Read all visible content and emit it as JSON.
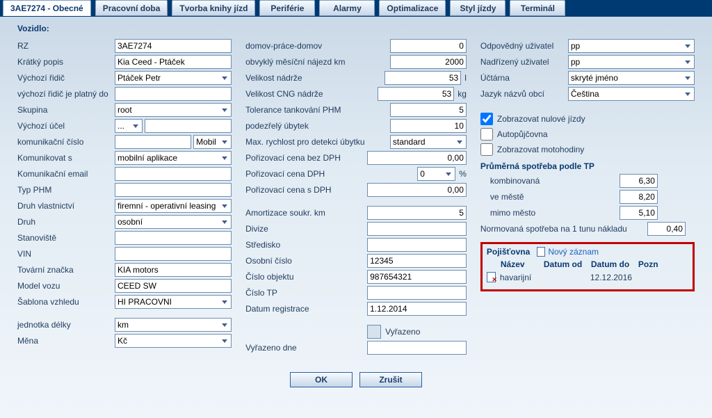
{
  "tabs": {
    "obecne": "3AE7274 - Obecné",
    "pracovni": "Pracovní doba",
    "tvorba": "Tvorba knihy jízd",
    "periferie": "Periférie",
    "alarmy": "Alarmy",
    "optimalizace": "Optimalizace",
    "styl": "Styl jízdy",
    "terminal": "Terminál"
  },
  "section": "Vozidlo:",
  "col1": {
    "rz": {
      "label": "RZ",
      "value": "3AE7274"
    },
    "kratky": {
      "label": "Krátký popis",
      "value": "Kia Ceed - Ptáček"
    },
    "ridic": {
      "label": "Výchozí řidič",
      "value": "Ptáček Petr"
    },
    "platny": {
      "label": "výchozí řidič je platný do",
      "value": ""
    },
    "skupina": {
      "label": "Skupina",
      "value": "root"
    },
    "ucel": {
      "label": "Výchozí účel",
      "value": "..."
    },
    "komcislo": {
      "label": "komunikační číslo",
      "value": "",
      "mode": "Mobil"
    },
    "komunikovat": {
      "label": "Komunikovat s",
      "value": "mobilní aplikace"
    },
    "email": {
      "label": "Komunikační email",
      "value": ""
    },
    "typphm": {
      "label": "Typ PHM",
      "value": ""
    },
    "vlastnictvi": {
      "label": "Druh vlastnictví",
      "value": "firemní - operativní leasing"
    },
    "druh": {
      "label": "Druh",
      "value": "osobní"
    },
    "stanoviste": {
      "label": "Stanoviště",
      "value": ""
    },
    "vin": {
      "label": "VIN",
      "value": ""
    },
    "znacka": {
      "label": "Tovární značka",
      "value": "KIA motors"
    },
    "model": {
      "label": "Model vozu",
      "value": "CEED SW"
    },
    "sablona": {
      "label": "Šablona vzhledu",
      "value": "HI PRACOVNI"
    },
    "delka": {
      "label": "jednotka délky",
      "value": "km"
    },
    "mena": {
      "label": "Měna",
      "value": "Kč"
    }
  },
  "col2": {
    "dpd": {
      "label": "domov-práce-domov",
      "value": "0"
    },
    "najezd": {
      "label": "obvyklý měsíční nájezd km",
      "value": "2000"
    },
    "nadrz": {
      "label": "Velikost nádrže",
      "value": "53",
      "unit": "l"
    },
    "cng": {
      "label": "Velikost CNG nádrže",
      "value": "53",
      "unit": "kg"
    },
    "tolerance": {
      "label": "Tolerance tankování PHM",
      "value": "5"
    },
    "ubytek": {
      "label": "podezřelý úbytek",
      "value": "10"
    },
    "maxrychl": {
      "label": "Max. rychlost pro detekci úbytku",
      "value": "standard"
    },
    "cenabez": {
      "label": "Pořizovací cena bez DPH",
      "value": "0,00"
    },
    "dph": {
      "label": "Pořizovací cena DPH",
      "sel": "0",
      "unit": "%"
    },
    "cenas": {
      "label": "Pořizovací cena s DPH",
      "value": "0,00"
    },
    "amort": {
      "label": "Amortizace soukr. km",
      "value": "5"
    },
    "divize": {
      "label": "Divize",
      "value": ""
    },
    "stredisko": {
      "label": "Středisko",
      "value": ""
    },
    "oscislo": {
      "label": "Osobní číslo",
      "value": "12345"
    },
    "objekt": {
      "label": "Číslo objektu",
      "value": "987654321"
    },
    "tp": {
      "label": "Číslo TP",
      "value": ""
    },
    "datumreg": {
      "label": "Datum registrace",
      "value": "1.12.2014"
    },
    "vyrazeno": {
      "label": "Vyřazeno"
    },
    "vyrazdne": {
      "label": "Vyřazeno dne",
      "value": ""
    }
  },
  "col3": {
    "odpovedny": {
      "label": "Odpovědný uživatel",
      "value": "pp"
    },
    "nadrizeny": {
      "label": "Nadřízený uživatel",
      "value": "pp"
    },
    "uctarna": {
      "label": "Účtárna",
      "value": "skryté jméno"
    },
    "jazyk": {
      "label": "Jazyk názvů obcí",
      "value": "Čeština"
    },
    "chk_nulove": "Zobrazovat nulové jízdy",
    "chk_autop": "Autopůjčovna",
    "chk_moto": "Zobrazovat motohodiny",
    "spotreba_title": "Průměrná spotřeba podle TP",
    "kombi": {
      "label": "kombinovaná",
      "value": "6,30"
    },
    "mesto": {
      "label": "ve městě",
      "value": "8,20"
    },
    "mimo": {
      "label": "mimo město",
      "value": "5,10"
    },
    "norm": {
      "label": "Normovaná spotřeba na 1 tunu nákladu",
      "value": "0,40"
    },
    "ins_title": "Pojišťovna",
    "ins_new": "Nový záznam",
    "ins_hd": {
      "nazev": "Název",
      "od": "Datum od",
      "do": "Datum do",
      "pozn": "Pozn"
    },
    "ins_row": {
      "nazev": "havarijní",
      "od": "",
      "do": "12.12.2016",
      "pozn": ""
    }
  },
  "buttons": {
    "ok": "OK",
    "cancel": "Zrušit"
  }
}
